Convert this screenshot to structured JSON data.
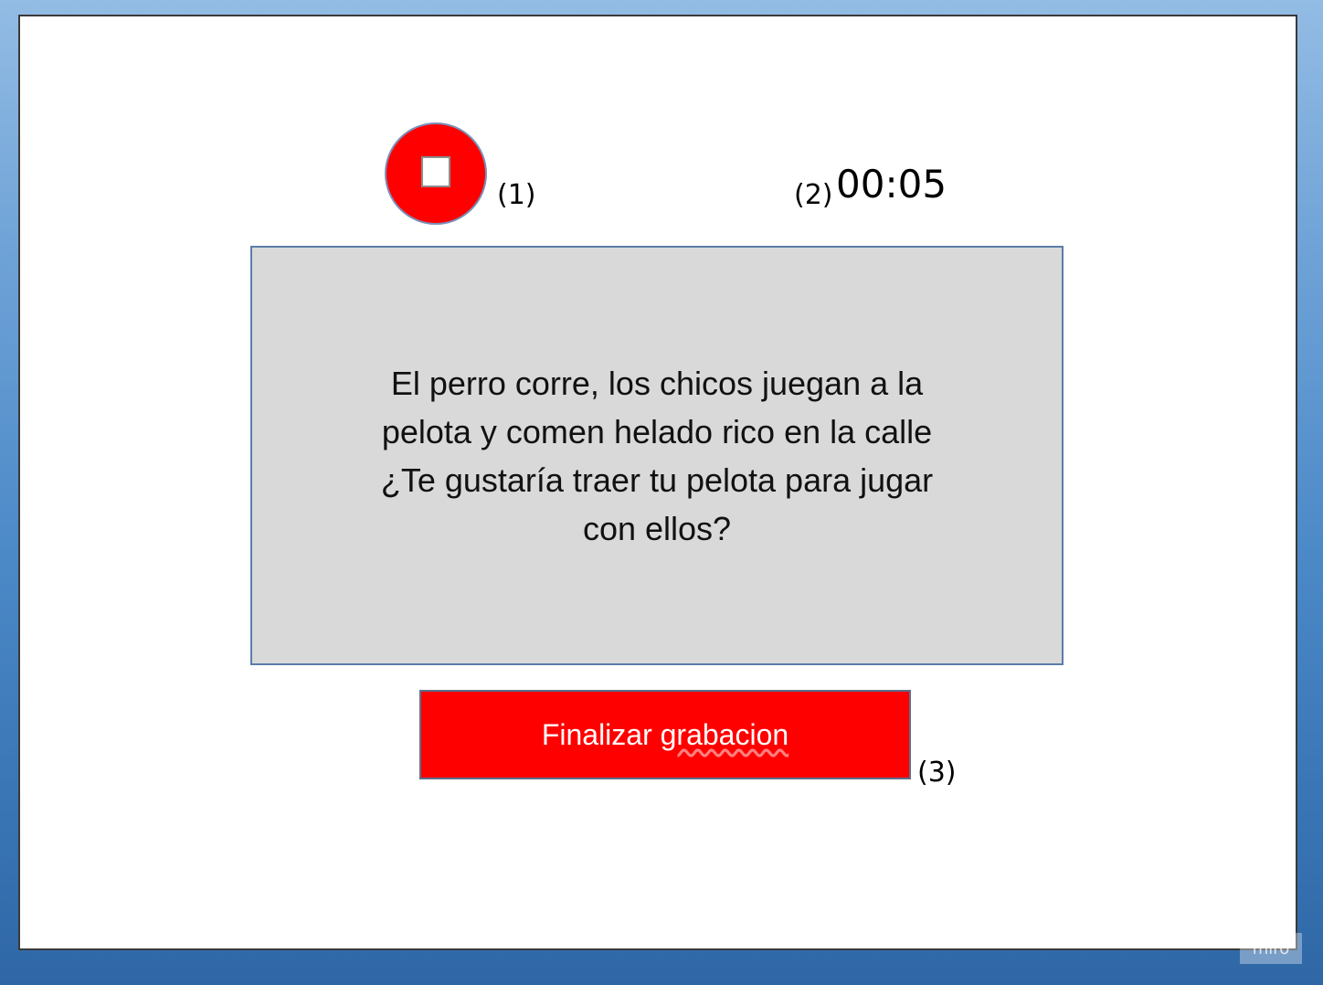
{
  "slide": {
    "stop_button": {
      "icon": "stop-icon",
      "color": "#ff0000"
    },
    "annotations": {
      "stop": "(1)",
      "timer": "(2)",
      "finish": "(3)"
    },
    "timer": {
      "value": "00:05"
    },
    "reading_text": {
      "line1": "El perro corre, los chicos juegan a la",
      "line2": "pelota y comen helado rico en la calle",
      "line3": "¿Te gustaría traer tu pelota para jugar",
      "line4": "con ellos?"
    },
    "finish_button": {
      "label_part1": "Finalizar",
      "label_part2": "grabacion",
      "color": "#ff0000"
    }
  },
  "watermark": {
    "text": "miro"
  }
}
